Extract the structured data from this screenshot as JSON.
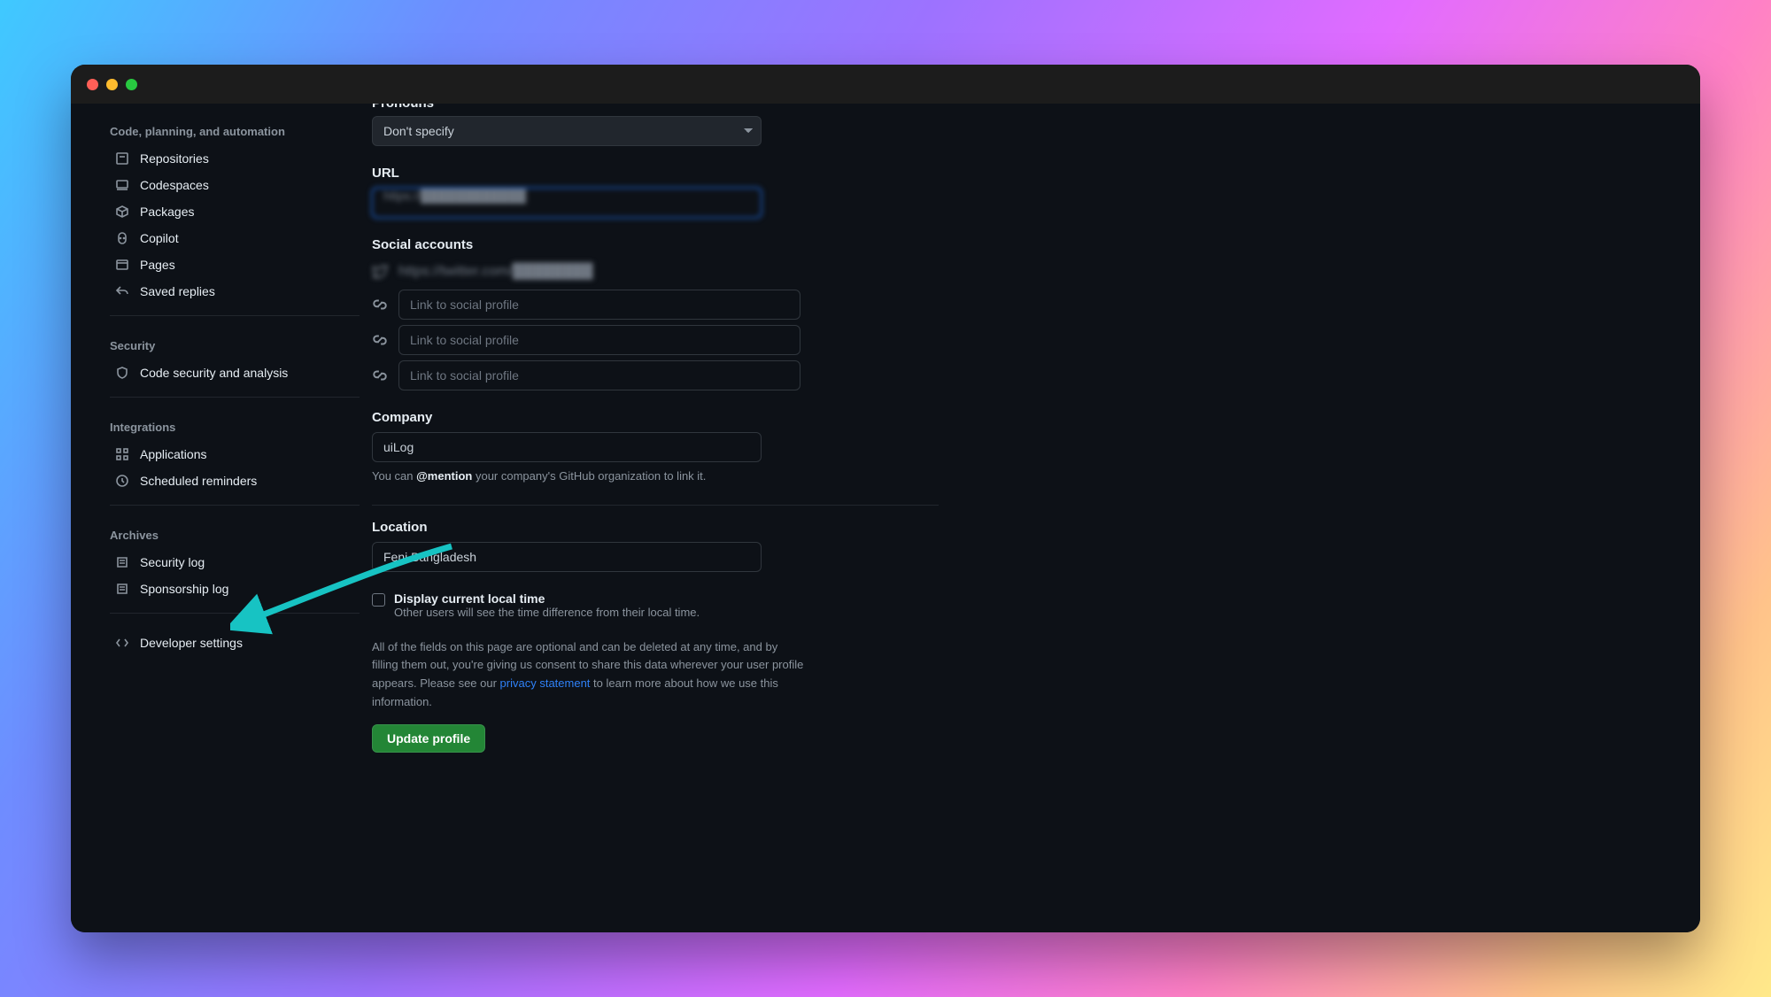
{
  "sections": {
    "code": {
      "header": "Code, planning, and automation",
      "items": [
        "Repositories",
        "Codespaces",
        "Packages",
        "Copilot",
        "Pages",
        "Saved replies"
      ]
    },
    "security": {
      "header": "Security",
      "items": [
        "Code security and analysis"
      ]
    },
    "integrations": {
      "header": "Integrations",
      "items": [
        "Applications",
        "Scheduled reminders"
      ]
    },
    "archives": {
      "header": "Archives",
      "items": [
        "Security log",
        "Sponsorship log"
      ]
    },
    "dev": {
      "label": "Developer settings"
    }
  },
  "form": {
    "pronouns": {
      "label": "Pronouns",
      "value": "Don't specify"
    },
    "url": {
      "label": "URL",
      "value": "https://████████████"
    },
    "social": {
      "label": "Social accounts",
      "twitter_value": "https://twitter.com/████████",
      "placeholder": "Link to social profile"
    },
    "company": {
      "label": "Company",
      "value": "uiLog",
      "hint_pre": "You can ",
      "hint_bold": "@mention",
      "hint_post": " your company's GitHub organization to link it."
    },
    "location": {
      "label": "Location",
      "value": "Feni Bangladesh"
    },
    "localtime": {
      "label": "Display current local time",
      "note": "Other users will see the time difference from their local time."
    },
    "fineprint": {
      "part1": "All of the fields on this page are optional and can be deleted at any time, and by filling them out, you're giving us consent to share this data wherever your user profile appears. Please see our ",
      "link": "privacy statement",
      "part2": " to learn more about how we use this information."
    },
    "submit": "Update profile"
  }
}
